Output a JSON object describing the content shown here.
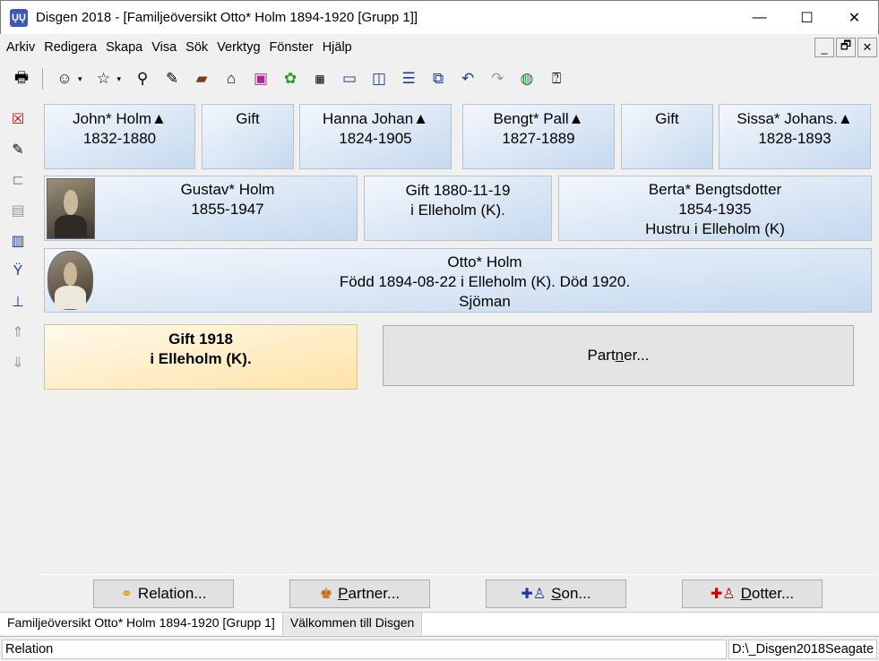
{
  "window": {
    "app_icon": "ŲŲ",
    "title": "Disgen 2018 - [Familjeöversikt Otto* Holm 1894-1920 [Grupp 1]]",
    "minimize": "—",
    "maximize": "☐",
    "close": "✕"
  },
  "menu": [
    "Arkiv",
    "Redigera",
    "Skapa",
    "Visa",
    "Sök",
    "Verktyg",
    "Fönster",
    "Hjälp"
  ],
  "mdi": {
    "minimize": "_",
    "restore": "🗗",
    "close": "✕"
  },
  "grandparents": [
    {
      "name": "John* Holm",
      "years": "1832-1880",
      "has_children_marker": "▲"
    },
    {
      "relation": "Gift"
    },
    {
      "name": "Hanna Johan",
      "years": "1824-1905",
      "has_children_marker": "▲"
    },
    {
      "name": "Bengt* Pall",
      "years": "1827-1889",
      "has_children_marker": "▲"
    },
    {
      "relation": "Gift"
    },
    {
      "name": "Sissa* Johans.",
      "years": "1828-1893",
      "has_children_marker": "▲"
    }
  ],
  "father": {
    "name": "Gustav* Holm",
    "years": "1855-1947"
  },
  "parents_marriage": {
    "line1": "Gift 1880-11-19",
    "line2": "i  Elleholm (K)."
  },
  "mother": {
    "name": "Berta* Bengtsdotter",
    "years": "1854-1935",
    "role": "Hustru  i Elleholm (K)"
  },
  "main_person": {
    "name": "Otto* Holm",
    "details": "Född 1894-08-22 i Elleholm (K). Död 1920.",
    "occupation": "Sjöman"
  },
  "own_marriage": {
    "line1": "Gift 1918",
    "line2": "i  Elleholm (K)."
  },
  "partner_placeholder": {
    "before": "Part",
    "underlined": "n",
    "after": "er..."
  },
  "buttons": [
    {
      "label": "Relation...",
      "icon": "rings-icon"
    },
    {
      "label_u": "P",
      "label_rest": "artner...",
      "icon": "couple-icon"
    },
    {
      "label_u": "S",
      "label_rest": "on...",
      "icon": "add-son-icon"
    },
    {
      "label_u": "D",
      "label_rest": "otter...",
      "icon": "add-daughter-icon"
    }
  ],
  "tabs": [
    "Familjeöversikt Otto* Holm 1894-1920 [Grupp 1]",
    "Välkommen till Disgen"
  ],
  "status": {
    "left": "Relation",
    "right": "D:\\_Disgen2018Seagate"
  },
  "colors": {
    "card_gradient_start": "#f3f7fc",
    "card_gradient_end": "#c6d9ef",
    "marriage_gradient_end": "#fde3a7"
  }
}
